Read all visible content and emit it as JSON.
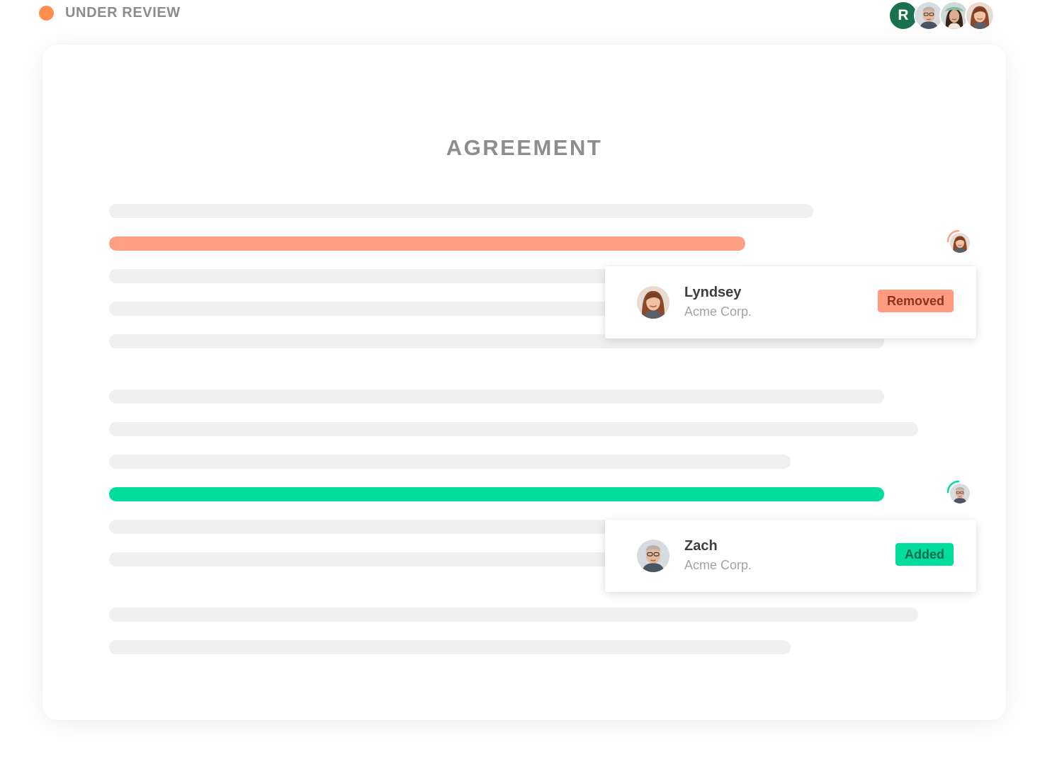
{
  "status": {
    "label": "UNDER REVIEW",
    "color": "#ff8e4f"
  },
  "collaborators": [
    {
      "type": "initial",
      "initial": "R",
      "color": "#1a7150"
    },
    {
      "type": "photo",
      "icon": "user-photo-man-glasses"
    },
    {
      "type": "photo",
      "icon": "user-photo-woman-hat"
    },
    {
      "type": "photo",
      "icon": "user-photo-woman-auburn"
    }
  ],
  "document": {
    "title": "AGREEMENT"
  },
  "changes": [
    {
      "name": "Lyndsey",
      "org": "Acme Corp.",
      "status": "Removed",
      "color": "#ffa085",
      "icon": "user-photo-woman-auburn"
    },
    {
      "name": "Zach",
      "org": "Acme Corp.",
      "status": "Added",
      "color": "#00dd9e",
      "icon": "user-photo-man-glasses"
    }
  ]
}
